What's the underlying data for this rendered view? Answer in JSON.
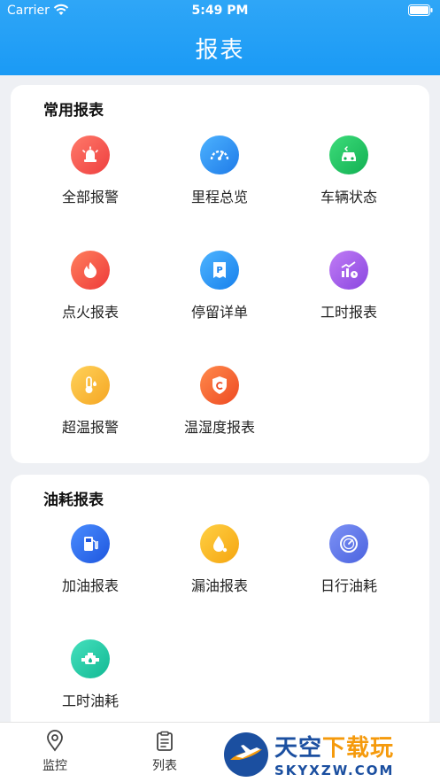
{
  "status_bar": {
    "carrier": "Carrier",
    "time": "5:49 PM"
  },
  "header": {
    "title": "报表"
  },
  "sections": [
    {
      "title": "常用报表",
      "items": [
        {
          "label": "全部报警",
          "icon": "siren-icon",
          "color": "#f0504c"
        },
        {
          "label": "里程总览",
          "icon": "speedometer-icon",
          "color": "#2a8df2"
        },
        {
          "label": "车辆状态",
          "icon": "car-icon",
          "color": "#20c060"
        },
        {
          "label": "点火报表",
          "icon": "fire-icon",
          "color": "#f2524a"
        },
        {
          "label": "停留详单",
          "icon": "parking-icon",
          "color": "#2a93f0"
        },
        {
          "label": "工时报表",
          "icon": "chart-clock-icon",
          "color": "#a35ae6"
        },
        {
          "label": "超温报警",
          "icon": "thermometer-icon",
          "color": "#f6b12a"
        },
        {
          "label": "温湿度报表",
          "icon": "shield-humidity-icon",
          "color": "#f3632e"
        }
      ]
    },
    {
      "title": "油耗报表",
      "items": [
        {
          "label": "加油报表",
          "icon": "fuel-pump-icon",
          "color": "#2f6ff0"
        },
        {
          "label": "漏油报表",
          "icon": "oil-drop-icon",
          "color": "#f5b21d"
        },
        {
          "label": "日行油耗",
          "icon": "gauge-icon",
          "color": "#5f79ec"
        },
        {
          "label": "工时油耗",
          "icon": "engine-icon",
          "color": "#1fc9a4"
        }
      ]
    }
  ],
  "tabbar": {
    "tabs": [
      {
        "label": "监控",
        "icon": "location-pin-icon"
      },
      {
        "label": "列表",
        "icon": "clipboard-icon"
      }
    ]
  },
  "watermark": {
    "cn_main": "天空",
    "cn_accent": "下载玩",
    "en": "SKYXZW.COM"
  }
}
